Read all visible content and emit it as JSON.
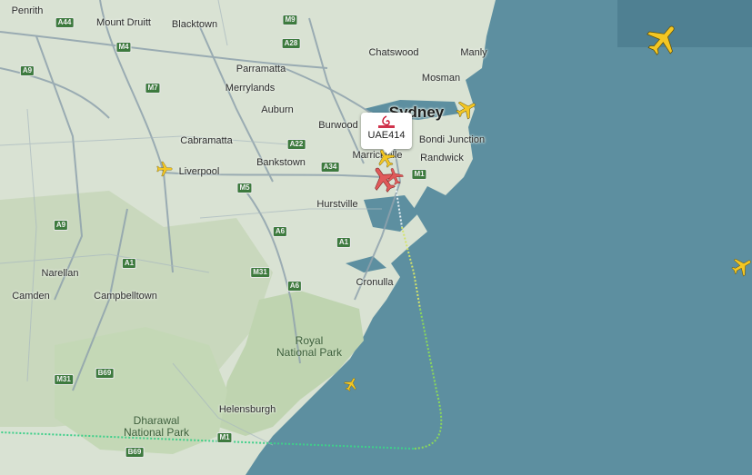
{
  "map": {
    "places": [
      {
        "id": "penrith",
        "name": "Penrith"
      },
      {
        "id": "mount-druitt",
        "name": "Mount Druitt"
      },
      {
        "id": "blacktown",
        "name": "Blacktown"
      },
      {
        "id": "chatswood",
        "name": "Chatswood"
      },
      {
        "id": "manly",
        "name": "Manly"
      },
      {
        "id": "parramatta",
        "name": "Parramatta"
      },
      {
        "id": "mosman",
        "name": "Mosman"
      },
      {
        "id": "merrylands",
        "name": "Merrylands"
      },
      {
        "id": "auburn",
        "name": "Auburn"
      },
      {
        "id": "sydney",
        "name": "Sydney"
      },
      {
        "id": "burwood",
        "name": "Burwood"
      },
      {
        "id": "cabramatta",
        "name": "Cabramatta"
      },
      {
        "id": "bondi-junction",
        "name": "Bondi Junction"
      },
      {
        "id": "marrickville",
        "name": "Marrickville"
      },
      {
        "id": "randwick",
        "name": "Randwick"
      },
      {
        "id": "bankstown",
        "name": "Bankstown"
      },
      {
        "id": "liverpool",
        "name": "Liverpool"
      },
      {
        "id": "hurstville",
        "name": "Hurstville"
      },
      {
        "id": "narellan",
        "name": "Narellan"
      },
      {
        "id": "cronulla",
        "name": "Cronulla"
      },
      {
        "id": "camden",
        "name": "Camden"
      },
      {
        "id": "campbelltown",
        "name": "Campbelltown"
      },
      {
        "id": "helensburgh",
        "name": "Helensburgh"
      }
    ],
    "parks": [
      {
        "id": "royal",
        "line1": "Royal",
        "line2": "National Park"
      },
      {
        "id": "dharawal",
        "line1": "Dharawal",
        "line2": "National Park"
      }
    ],
    "roads": [
      "A44",
      "M9",
      "M4",
      "A28",
      "A9",
      "M7",
      "A22",
      "A34",
      "M1",
      "M5",
      "A9",
      "A6",
      "A1",
      "M31",
      "A6",
      "A1",
      "M31",
      "B69",
      "B69",
      "M1"
    ]
  },
  "flight": {
    "callsign": "UAE414",
    "airline_logo": "Emirates",
    "selected_color": "#e05a5a"
  },
  "colors": {
    "water": "#5d8fa0",
    "plane_yellow": "#f3c623",
    "trail_start": "#e8f0f4",
    "trail_mid": "#b6d63a",
    "trail_end": "#3fcf8a"
  }
}
